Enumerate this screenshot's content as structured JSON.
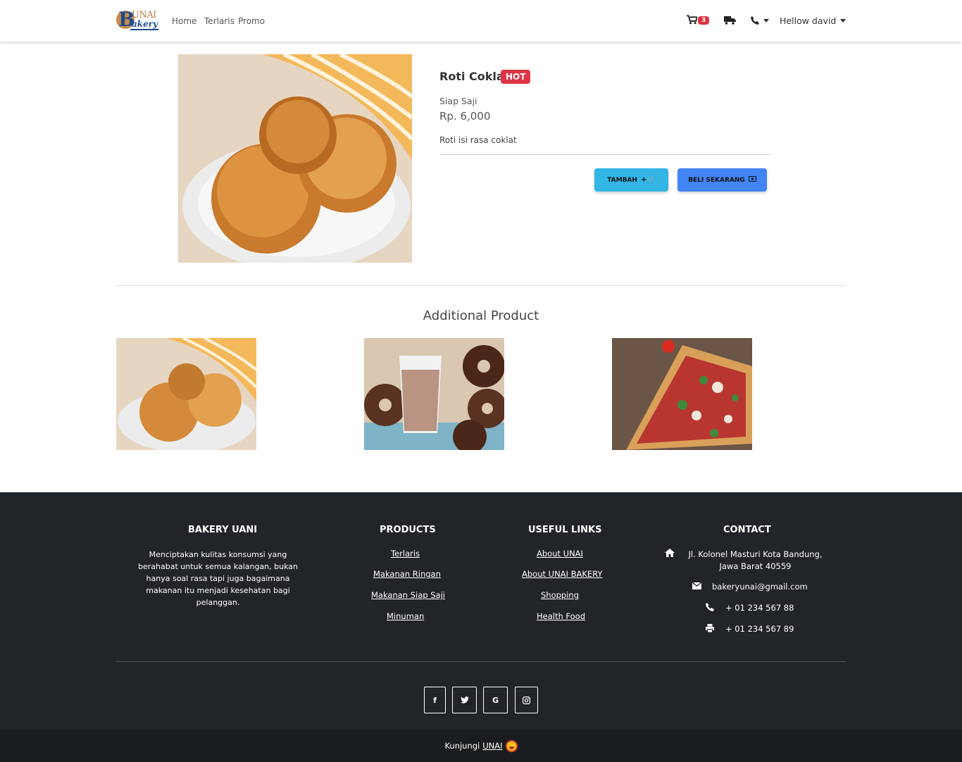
{
  "nav": {
    "logo_top": "UNAI",
    "logo_bottom": "akery",
    "logo_b": "B",
    "links": [
      "Home",
      "Terlaris",
      "Promo"
    ],
    "cart_count": "3",
    "user_label": "Hellow david"
  },
  "product": {
    "title": "Roti Coklat",
    "badge": "HOT",
    "category": "Siap Saji",
    "price": "Rp. 6,000",
    "description": "Roti isi rasa coklat",
    "add_button": "TAMBAH",
    "buy_button": "BELI SEKARANG"
  },
  "additional": {
    "title": "Additional Product"
  },
  "footer": {
    "about_title": "BAKERY UANI",
    "about_text": "Menciptakan kulitas konsumsi yang berahabat untuk semua kalangan, bukan hanya soal rasa tapi juga bagaimana makanan itu menjadi kesehatan bagi pelanggan.",
    "products_title": "PRODUCTS",
    "products": [
      "Terlaris",
      "Makanan Ringan",
      "Makanan Siap Saji",
      "Minuman"
    ],
    "links_title": "USEFUL LINKS",
    "links": [
      "About UNAI",
      "About UNAI BAKERY",
      "Shopping",
      "Health Food"
    ],
    "contact_title": "CONTACT",
    "address": "Jl. Kolonel Masturi Kota Bandung, Jawa Barat 40559",
    "email": "bakeryunai@gmail.com",
    "phone": "+ 01 234 567 88",
    "fax": "+ 01 234 567 89",
    "social": [
      "f",
      "t",
      "G",
      "ig"
    ],
    "bottom_text": "Kunjungi",
    "bottom_link": "UNAI"
  },
  "colors": {
    "accent_info": "#33b5e5",
    "accent_primary": "#4285f4",
    "danger": "#dc3545",
    "footer_bg": "#212529"
  }
}
